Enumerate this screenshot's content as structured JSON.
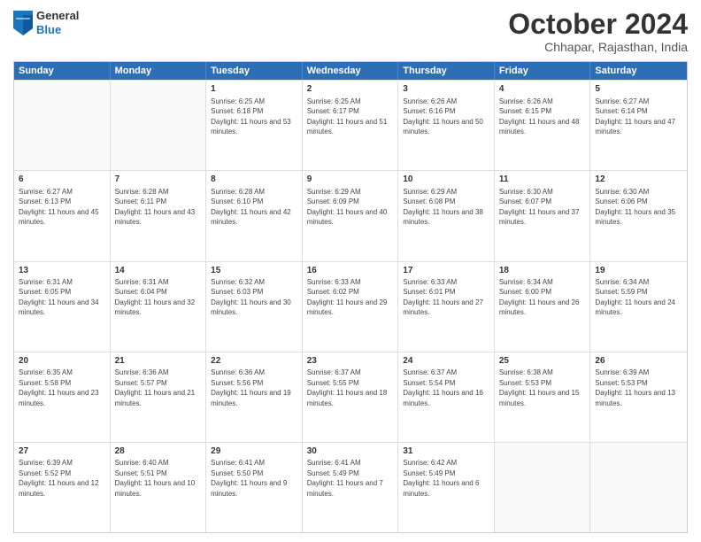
{
  "header": {
    "logo": {
      "general": "General",
      "blue": "Blue"
    },
    "title": "October 2024",
    "subtitle": "Chhapar, Rajasthan, India"
  },
  "calendar": {
    "days": [
      "Sunday",
      "Monday",
      "Tuesday",
      "Wednesday",
      "Thursday",
      "Friday",
      "Saturday"
    ],
    "rows": [
      [
        {
          "day": "",
          "empty": true
        },
        {
          "day": "",
          "empty": true
        },
        {
          "day": "1",
          "sunrise": "Sunrise: 6:25 AM",
          "sunset": "Sunset: 6:18 PM",
          "daylight": "Daylight: 11 hours and 53 minutes."
        },
        {
          "day": "2",
          "sunrise": "Sunrise: 6:25 AM",
          "sunset": "Sunset: 6:17 PM",
          "daylight": "Daylight: 11 hours and 51 minutes."
        },
        {
          "day": "3",
          "sunrise": "Sunrise: 6:26 AM",
          "sunset": "Sunset: 6:16 PM",
          "daylight": "Daylight: 11 hours and 50 minutes."
        },
        {
          "day": "4",
          "sunrise": "Sunrise: 6:26 AM",
          "sunset": "Sunset: 6:15 PM",
          "daylight": "Daylight: 11 hours and 48 minutes."
        },
        {
          "day": "5",
          "sunrise": "Sunrise: 6:27 AM",
          "sunset": "Sunset: 6:14 PM",
          "daylight": "Daylight: 11 hours and 47 minutes."
        }
      ],
      [
        {
          "day": "6",
          "sunrise": "Sunrise: 6:27 AM",
          "sunset": "Sunset: 6:13 PM",
          "daylight": "Daylight: 11 hours and 45 minutes."
        },
        {
          "day": "7",
          "sunrise": "Sunrise: 6:28 AM",
          "sunset": "Sunset: 6:11 PM",
          "daylight": "Daylight: 11 hours and 43 minutes."
        },
        {
          "day": "8",
          "sunrise": "Sunrise: 6:28 AM",
          "sunset": "Sunset: 6:10 PM",
          "daylight": "Daylight: 11 hours and 42 minutes."
        },
        {
          "day": "9",
          "sunrise": "Sunrise: 6:29 AM",
          "sunset": "Sunset: 6:09 PM",
          "daylight": "Daylight: 11 hours and 40 minutes."
        },
        {
          "day": "10",
          "sunrise": "Sunrise: 6:29 AM",
          "sunset": "Sunset: 6:08 PM",
          "daylight": "Daylight: 11 hours and 38 minutes."
        },
        {
          "day": "11",
          "sunrise": "Sunrise: 6:30 AM",
          "sunset": "Sunset: 6:07 PM",
          "daylight": "Daylight: 11 hours and 37 minutes."
        },
        {
          "day": "12",
          "sunrise": "Sunrise: 6:30 AM",
          "sunset": "Sunset: 6:06 PM",
          "daylight": "Daylight: 11 hours and 35 minutes."
        }
      ],
      [
        {
          "day": "13",
          "sunrise": "Sunrise: 6:31 AM",
          "sunset": "Sunset: 6:05 PM",
          "daylight": "Daylight: 11 hours and 34 minutes."
        },
        {
          "day": "14",
          "sunrise": "Sunrise: 6:31 AM",
          "sunset": "Sunset: 6:04 PM",
          "daylight": "Daylight: 11 hours and 32 minutes."
        },
        {
          "day": "15",
          "sunrise": "Sunrise: 6:32 AM",
          "sunset": "Sunset: 6:03 PM",
          "daylight": "Daylight: 11 hours and 30 minutes."
        },
        {
          "day": "16",
          "sunrise": "Sunrise: 6:33 AM",
          "sunset": "Sunset: 6:02 PM",
          "daylight": "Daylight: 11 hours and 29 minutes."
        },
        {
          "day": "17",
          "sunrise": "Sunrise: 6:33 AM",
          "sunset": "Sunset: 6:01 PM",
          "daylight": "Daylight: 11 hours and 27 minutes."
        },
        {
          "day": "18",
          "sunrise": "Sunrise: 6:34 AM",
          "sunset": "Sunset: 6:00 PM",
          "daylight": "Daylight: 11 hours and 26 minutes."
        },
        {
          "day": "19",
          "sunrise": "Sunrise: 6:34 AM",
          "sunset": "Sunset: 5:59 PM",
          "daylight": "Daylight: 11 hours and 24 minutes."
        }
      ],
      [
        {
          "day": "20",
          "sunrise": "Sunrise: 6:35 AM",
          "sunset": "Sunset: 5:58 PM",
          "daylight": "Daylight: 11 hours and 23 minutes."
        },
        {
          "day": "21",
          "sunrise": "Sunrise: 6:36 AM",
          "sunset": "Sunset: 5:57 PM",
          "daylight": "Daylight: 11 hours and 21 minutes."
        },
        {
          "day": "22",
          "sunrise": "Sunrise: 6:36 AM",
          "sunset": "Sunset: 5:56 PM",
          "daylight": "Daylight: 11 hours and 19 minutes."
        },
        {
          "day": "23",
          "sunrise": "Sunrise: 6:37 AM",
          "sunset": "Sunset: 5:55 PM",
          "daylight": "Daylight: 11 hours and 18 minutes."
        },
        {
          "day": "24",
          "sunrise": "Sunrise: 6:37 AM",
          "sunset": "Sunset: 5:54 PM",
          "daylight": "Daylight: 11 hours and 16 minutes."
        },
        {
          "day": "25",
          "sunrise": "Sunrise: 6:38 AM",
          "sunset": "Sunset: 5:53 PM",
          "daylight": "Daylight: 11 hours and 15 minutes."
        },
        {
          "day": "26",
          "sunrise": "Sunrise: 6:39 AM",
          "sunset": "Sunset: 5:53 PM",
          "daylight": "Daylight: 11 hours and 13 minutes."
        }
      ],
      [
        {
          "day": "27",
          "sunrise": "Sunrise: 6:39 AM",
          "sunset": "Sunset: 5:52 PM",
          "daylight": "Daylight: 11 hours and 12 minutes."
        },
        {
          "day": "28",
          "sunrise": "Sunrise: 6:40 AM",
          "sunset": "Sunset: 5:51 PM",
          "daylight": "Daylight: 11 hours and 10 minutes."
        },
        {
          "day": "29",
          "sunrise": "Sunrise: 6:41 AM",
          "sunset": "Sunset: 5:50 PM",
          "daylight": "Daylight: 11 hours and 9 minutes."
        },
        {
          "day": "30",
          "sunrise": "Sunrise: 6:41 AM",
          "sunset": "Sunset: 5:49 PM",
          "daylight": "Daylight: 11 hours and 7 minutes."
        },
        {
          "day": "31",
          "sunrise": "Sunrise: 6:42 AM",
          "sunset": "Sunset: 5:49 PM",
          "daylight": "Daylight: 11 hours and 6 minutes."
        },
        {
          "day": "",
          "empty": true
        },
        {
          "day": "",
          "empty": true
        }
      ]
    ]
  }
}
